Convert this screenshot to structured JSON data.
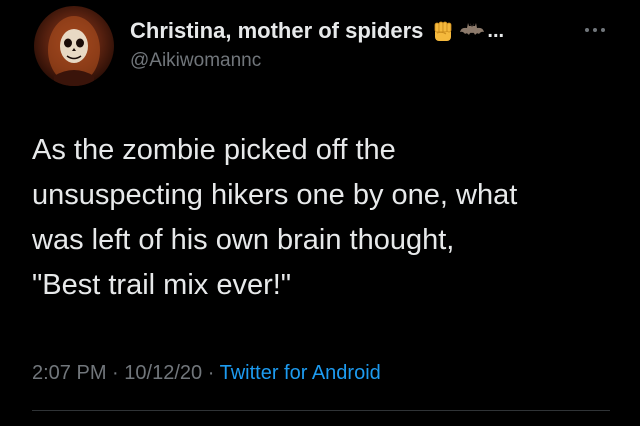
{
  "tweet": {
    "author": {
      "display_name": "Christina, mother of spiders",
      "name_suffix": "...",
      "handle": "@Aikiwomannc",
      "name_emojis": [
        "raised-fist-emoji",
        "bat-emoji"
      ]
    },
    "text_lines": [
      "As the zombie picked off the",
      "unsuspecting hikers one by one, what",
      "was left of his own brain thought,",
      "\"Best trail mix ever!\""
    ],
    "time": "2:07 PM",
    "date": "10/12/20",
    "separator": "·",
    "source": "Twitter for Android"
  },
  "icons": {
    "more": "more-options-icon"
  },
  "colors": {
    "background": "#000000",
    "primary_text": "#e7e9ea",
    "secondary_text": "#71767b",
    "link": "#1d9bf0",
    "divider": "#2f3336"
  }
}
